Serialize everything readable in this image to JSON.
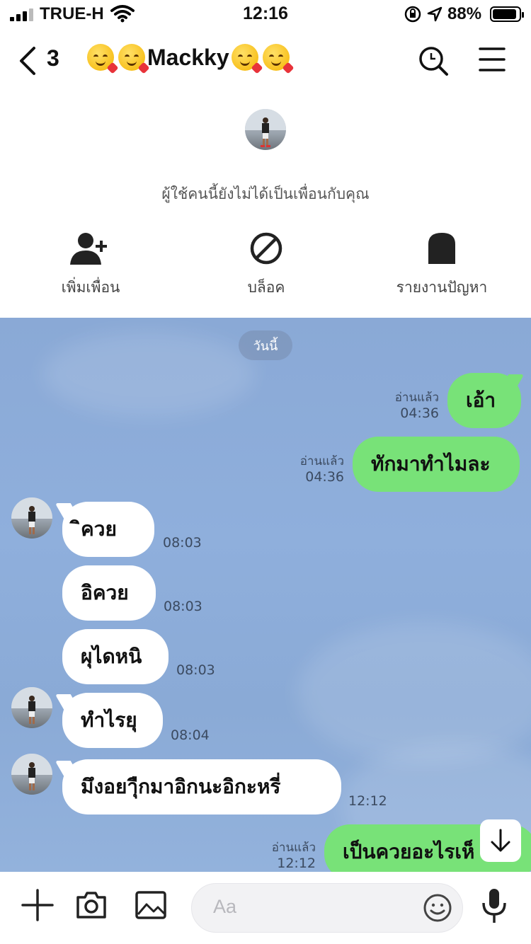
{
  "status_bar": {
    "carrier": "TRUE-H",
    "time": "12:16",
    "battery": "88%"
  },
  "header": {
    "back_count": "3",
    "contact_name": "Mackky",
    "title_emoji_icon": "smiling-face-with-hearts-icon"
  },
  "profile": {
    "notice": "ผู้ใช้คนนี้ยังไม่ได้เป็นเพื่อนกับคุณ",
    "actions": [
      {
        "label": "เพิ่มเพื่อน",
        "icon": "add-friend-icon"
      },
      {
        "label": "บล็อค",
        "icon": "block-icon"
      },
      {
        "label": "รายงานปัญหา",
        "icon": "report-icon"
      }
    ]
  },
  "chat": {
    "date_label": "วันนี้",
    "messages": [
      {
        "dir": "out",
        "text": "เอ้า",
        "read": "อ่านแล้ว",
        "time": "04:36"
      },
      {
        "dir": "out",
        "text": "ทักมาทำไมละ",
        "read": "อ่านแล้ว",
        "time": "04:36"
      },
      {
        "dir": "in",
        "text": "ิควย",
        "time": "08:03"
      },
      {
        "dir": "in",
        "text": "อิควย",
        "time": "08:03"
      },
      {
        "dir": "in",
        "text": "ผุไดหนิ",
        "time": "08:03"
      },
      {
        "dir": "in",
        "text": "ทำไรยุ",
        "time": "08:04"
      },
      {
        "dir": "in",
        "text": "มึงอยาืุกมาอิกนะอิกะหรี่",
        "time": "12:12"
      },
      {
        "dir": "out",
        "text": "เป็นควยอะไรเห็",
        "read": "อ่านแล้ว",
        "time": "12:12"
      }
    ]
  },
  "composer": {
    "placeholder": "Aa"
  },
  "colors": {
    "outgoing_bubble": "#78e278",
    "incoming_bubble": "#ffffff",
    "chat_background": "#8aa9d6"
  }
}
